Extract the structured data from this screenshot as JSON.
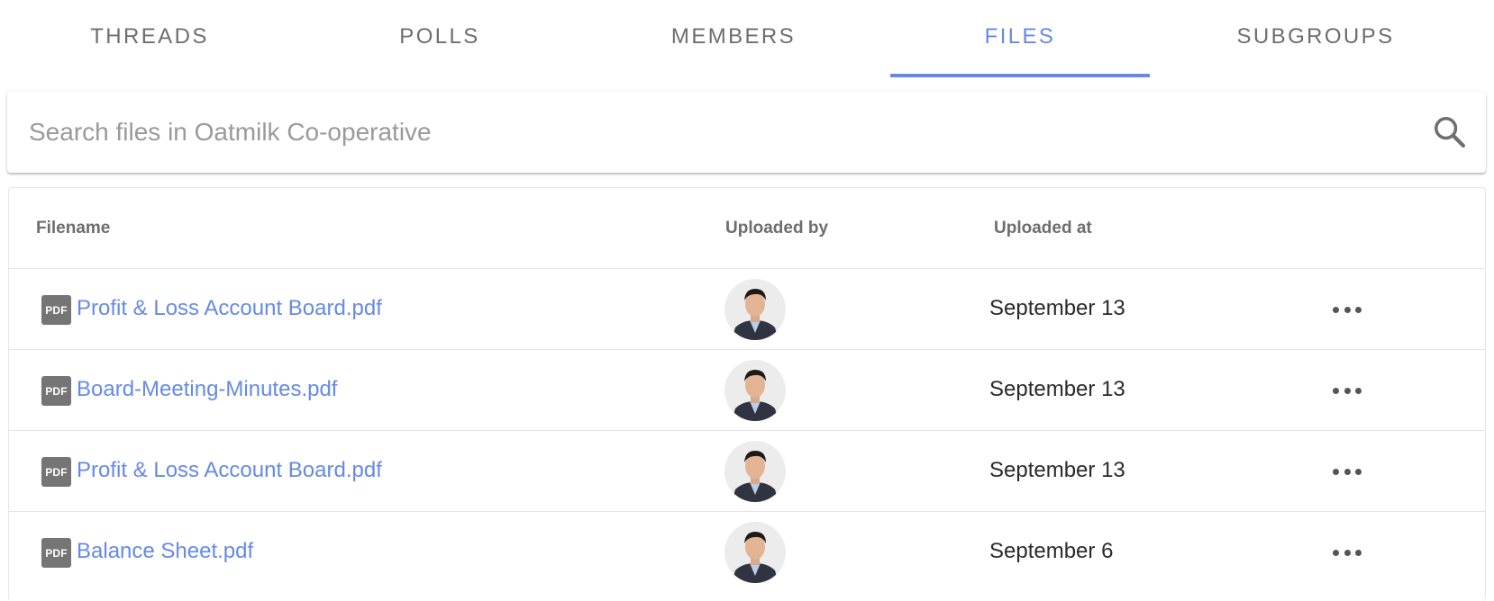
{
  "tabs": [
    {
      "label": "THREADS",
      "active": false
    },
    {
      "label": "POLLS",
      "active": false
    },
    {
      "label": "MEMBERS",
      "active": false
    },
    {
      "label": "FILES",
      "active": true
    },
    {
      "label": "SUBGROUPS",
      "active": false
    }
  ],
  "search": {
    "placeholder": "Search files in Oatmilk Co-operative",
    "value": "",
    "icon": "search-icon"
  },
  "table": {
    "headers": {
      "filename": "Filename",
      "uploaded_by": "Uploaded by",
      "uploaded_at": "Uploaded at"
    },
    "rows": [
      {
        "file_icon": "PDF",
        "filename": "Profit & Loss Account Board.pdf",
        "uploaded_at": "September 13"
      },
      {
        "file_icon": "PDF",
        "filename": "Board-Meeting-Minutes.pdf",
        "uploaded_at": "September 13"
      },
      {
        "file_icon": "PDF",
        "filename": "Profit & Loss Account Board.pdf",
        "uploaded_at": "September 13"
      },
      {
        "file_icon": "PDF",
        "filename": "Balance Sheet.pdf",
        "uploaded_at": "September 6"
      }
    ]
  },
  "colors": {
    "accent": "#658ae6",
    "tab_inactive": "#6e6e6e",
    "pdf_icon_bg": "#757575"
  }
}
